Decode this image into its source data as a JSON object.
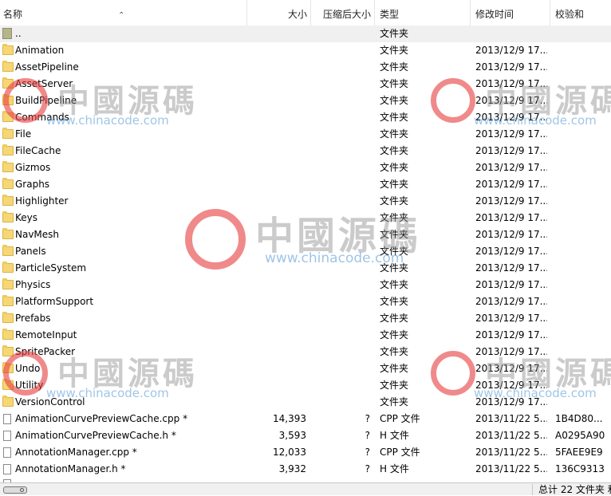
{
  "columns": {
    "name": "名称",
    "size": "大小",
    "compressed": "压缩后大小",
    "type": "类型",
    "modified": "修改时间",
    "crc": "校验和"
  },
  "rows": [
    {
      "icon": "up-folder-icon",
      "name": "..",
      "size": "",
      "compressed": "",
      "type": "文件夹",
      "modified": "",
      "crc": ""
    },
    {
      "icon": "folder-icon",
      "name": "Animation",
      "size": "",
      "compressed": "",
      "type": "文件夹",
      "modified": "2013/12/9 17...",
      "crc": ""
    },
    {
      "icon": "folder-icon",
      "name": "AssetPipeline",
      "size": "",
      "compressed": "",
      "type": "文件夹",
      "modified": "2013/12/9 17...",
      "crc": ""
    },
    {
      "icon": "folder-icon",
      "name": "AssetServer",
      "size": "",
      "compressed": "",
      "type": "文件夹",
      "modified": "2013/12/9 17...",
      "crc": ""
    },
    {
      "icon": "folder-icon",
      "name": "BuildPipeline",
      "size": "",
      "compressed": "",
      "type": "文件夹",
      "modified": "2013/12/9 17...",
      "crc": ""
    },
    {
      "icon": "folder-icon",
      "name": "Commands",
      "size": "",
      "compressed": "",
      "type": "文件夹",
      "modified": "2013/12/9 17...",
      "crc": ""
    },
    {
      "icon": "folder-icon",
      "name": "File",
      "size": "",
      "compressed": "",
      "type": "文件夹",
      "modified": "2013/12/9 17...",
      "crc": ""
    },
    {
      "icon": "folder-icon",
      "name": "FileCache",
      "size": "",
      "compressed": "",
      "type": "文件夹",
      "modified": "2013/12/9 17...",
      "crc": ""
    },
    {
      "icon": "folder-icon",
      "name": "Gizmos",
      "size": "",
      "compressed": "",
      "type": "文件夹",
      "modified": "2013/12/9 17...",
      "crc": ""
    },
    {
      "icon": "folder-icon",
      "name": "Graphs",
      "size": "",
      "compressed": "",
      "type": "文件夹",
      "modified": "2013/12/9 17...",
      "crc": ""
    },
    {
      "icon": "folder-icon",
      "name": "Highlighter",
      "size": "",
      "compressed": "",
      "type": "文件夹",
      "modified": "2013/12/9 17...",
      "crc": ""
    },
    {
      "icon": "folder-icon",
      "name": "Keys",
      "size": "",
      "compressed": "",
      "type": "文件夹",
      "modified": "2013/12/9 17...",
      "crc": ""
    },
    {
      "icon": "folder-icon",
      "name": "NavMesh",
      "size": "",
      "compressed": "",
      "type": "文件夹",
      "modified": "2013/12/9 17...",
      "crc": ""
    },
    {
      "icon": "folder-icon",
      "name": "Panels",
      "size": "",
      "compressed": "",
      "type": "文件夹",
      "modified": "2013/12/9 17...",
      "crc": ""
    },
    {
      "icon": "folder-icon",
      "name": "ParticleSystem",
      "size": "",
      "compressed": "",
      "type": "文件夹",
      "modified": "2013/12/9 17...",
      "crc": ""
    },
    {
      "icon": "folder-icon",
      "name": "Physics",
      "size": "",
      "compressed": "",
      "type": "文件夹",
      "modified": "2013/12/9 17...",
      "crc": ""
    },
    {
      "icon": "folder-icon",
      "name": "PlatformSupport",
      "size": "",
      "compressed": "",
      "type": "文件夹",
      "modified": "2013/12/9 17...",
      "crc": ""
    },
    {
      "icon": "folder-icon",
      "name": "Prefabs",
      "size": "",
      "compressed": "",
      "type": "文件夹",
      "modified": "2013/12/9 17...",
      "crc": ""
    },
    {
      "icon": "folder-icon",
      "name": "RemoteInput",
      "size": "",
      "compressed": "",
      "type": "文件夹",
      "modified": "2013/12/9 17...",
      "crc": ""
    },
    {
      "icon": "folder-icon",
      "name": "SpritePacker",
      "size": "",
      "compressed": "",
      "type": "文件夹",
      "modified": "2013/12/9 17...",
      "crc": ""
    },
    {
      "icon": "folder-icon",
      "name": "Undo",
      "size": "",
      "compressed": "",
      "type": "文件夹",
      "modified": "2013/12/9 17...",
      "crc": ""
    },
    {
      "icon": "folder-icon",
      "name": "Utility",
      "size": "",
      "compressed": "",
      "type": "文件夹",
      "modified": "2013/12/9 17...",
      "crc": ""
    },
    {
      "icon": "folder-icon",
      "name": "VersionControl",
      "size": "",
      "compressed": "",
      "type": "文件夹",
      "modified": "2013/12/9 17...",
      "crc": ""
    },
    {
      "icon": "file-icon",
      "name": "AnimationCurvePreviewCache.cpp *",
      "size": "14,393",
      "compressed": "?",
      "type": "CPP 文件",
      "modified": "2013/11/22 5...",
      "crc": "1B4D80..."
    },
    {
      "icon": "file-icon",
      "name": "AnimationCurvePreviewCache.h *",
      "size": "3,593",
      "compressed": "?",
      "type": "H 文件",
      "modified": "2013/11/22 5...",
      "crc": "A0295A90"
    },
    {
      "icon": "file-icon",
      "name": "AnnotationManager.cpp *",
      "size": "12,033",
      "compressed": "?",
      "type": "CPP 文件",
      "modified": "2013/11/22 5...",
      "crc": "5FAEE9E9"
    },
    {
      "icon": "file-icon",
      "name": "AnnotationManager.h *",
      "size": "3,932",
      "compressed": "?",
      "type": "H 文件",
      "modified": "2013/11/22 5...",
      "crc": "136C9313"
    }
  ],
  "status": {
    "summary": "总计 22 文件夹 和"
  },
  "watermark": {
    "chinese": "中國源碼",
    "url": "www.chinacode.com"
  }
}
